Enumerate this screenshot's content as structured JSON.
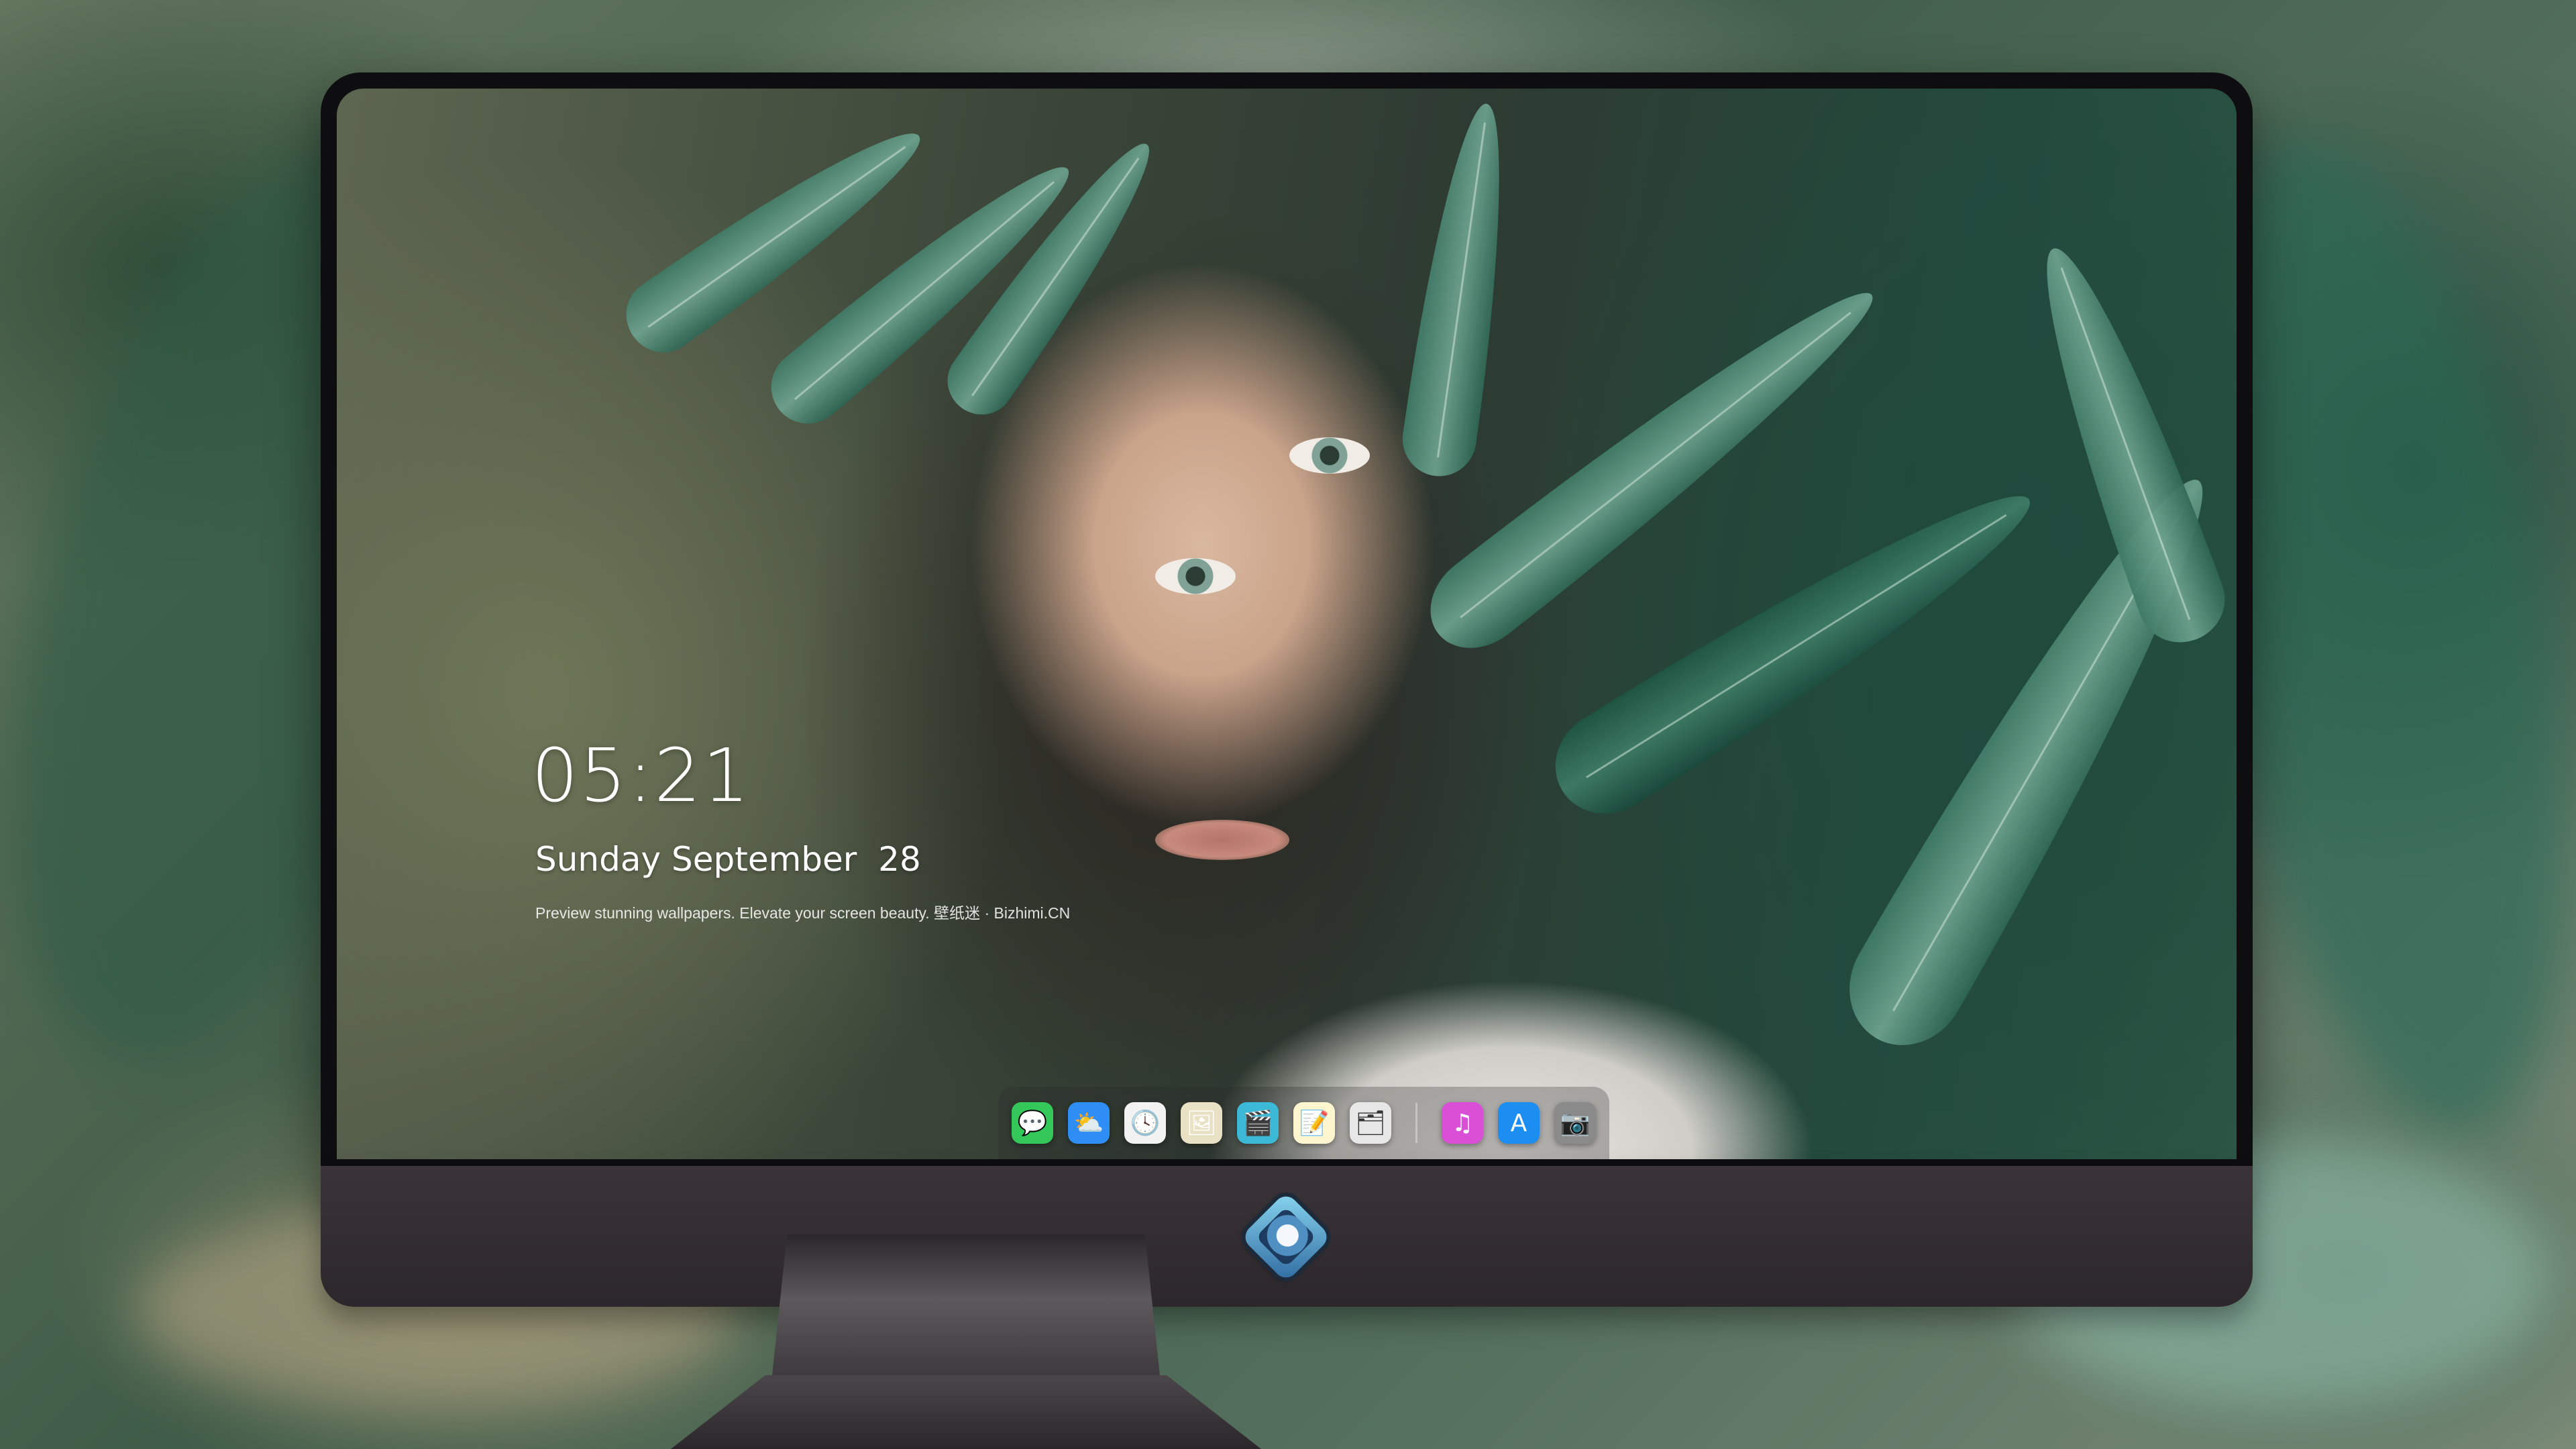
{
  "lock_screen": {
    "time": "05:21",
    "date": "Sunday September  28",
    "tagline": "Preview stunning wallpapers. Elevate your screen beauty. 壁纸迷 · Bizhimi.CN"
  },
  "dock": {
    "apps": [
      {
        "name": "messages-icon",
        "glyph": "💬",
        "color": "#34c759"
      },
      {
        "name": "weather-icon",
        "glyph": "⛅",
        "color": "#2f8ef5"
      },
      {
        "name": "clock-icon",
        "glyph": "🕓",
        "color": "#f2f2f2"
      },
      {
        "name": "preview-icon",
        "glyph": "🖼",
        "color": "#e9e1c4"
      },
      {
        "name": "claquette-icon",
        "glyph": "🎬",
        "color": "#3cb9d6"
      },
      {
        "name": "notes-icon",
        "glyph": "📝",
        "color": "#fff6cf"
      },
      {
        "name": "photos-icon",
        "glyph": "🗂",
        "color": "#e7e7e7"
      },
      {
        "name": "music-icon",
        "glyph": "♫",
        "color": "#d94fd6"
      },
      {
        "name": "app-store-icon",
        "glyph": "A",
        "color": "#1c8ef2"
      },
      {
        "name": "camera-icon",
        "glyph": "📷",
        "color": "#8a8a8a"
      }
    ]
  }
}
